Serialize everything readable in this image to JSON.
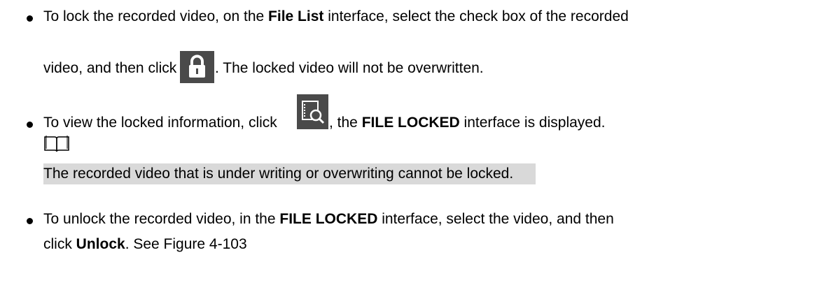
{
  "bullets": [
    {
      "line1_pre": "To lock the recorded video, on the ",
      "line1_bold": "File List",
      "line1_post": " interface, select the check box of the recorded",
      "line2_pre": "video, and then click ",
      "icon": "lock-icon",
      "line2_post": ". The locked video will not be overwritten."
    },
    {
      "pre": "To view the locked information, click ",
      "icon": "file-search-icon",
      "mid": ", the ",
      "bold": "FILE LOCKED",
      "post": " interface is displayed."
    },
    {
      "line1_pre": "To unlock the recorded video, in the ",
      "line1_bold": "FILE LOCKED",
      "line1_post": " interface, select the video, and then",
      "line2_pre": "click ",
      "line2_bold": "Unlock",
      "line2_post": ". See Figure 4-103"
    }
  ],
  "note": {
    "icon": "book-icon",
    "text": "The recorded video that is under writing or overwriting cannot be locked."
  },
  "colors": {
    "text": "#000000",
    "icon_bg": "#4a4a4a",
    "note_highlight": "#d9d9d9"
  }
}
